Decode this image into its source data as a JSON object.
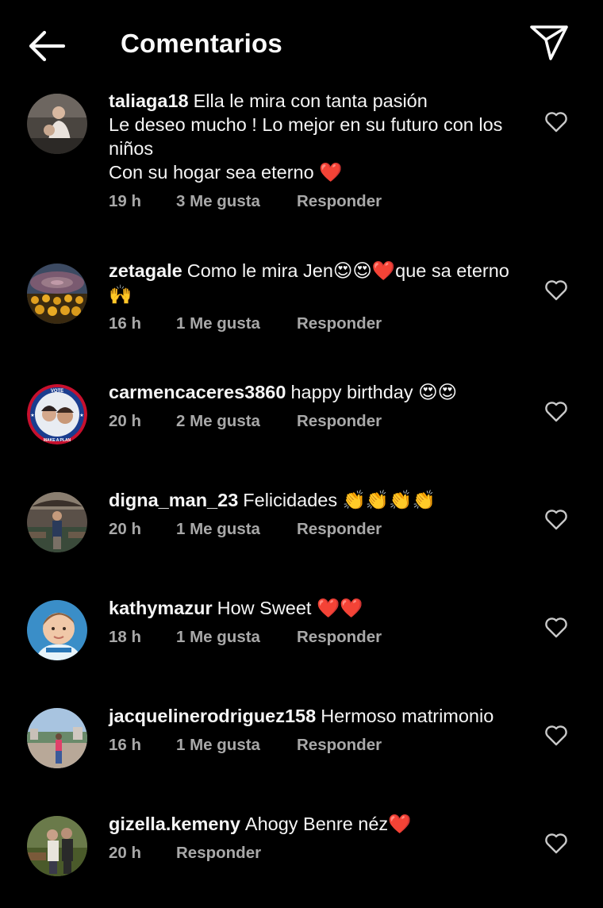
{
  "header": {
    "title": "Comentarios",
    "back_icon": "arrow-left-icon",
    "share_icon": "paper-plane-icon"
  },
  "comments": [
    {
      "username": "taliaga18",
      "text": "Ella le mira con tanta pasión\nLe deseo mucho ! Lo mejor en su futuro con los niños\nCon su hogar sea eterno ❤️",
      "time": "19 h",
      "likes": "3 Me gusta",
      "reply": "Responder"
    },
    {
      "username": "zetagale",
      "text": "Como le mira Jen😍😍❤️que sa eterno🙌",
      "time": "16 h",
      "likes": "1 Me gusta",
      "reply": "Responder"
    },
    {
      "username": "carmencaceres3860",
      "text": "happy birthday 😍😍",
      "time": "20 h",
      "likes": "2 Me gusta",
      "reply": "Responder",
      "avatar_badge_top": "VOTE",
      "avatar_badge_bottom": "MAKE A PLAN"
    },
    {
      "username": "digna_man_23",
      "text": "Felicidades 👏👏👏👏",
      "time": "20 h",
      "likes": "1 Me gusta",
      "reply": "Responder"
    },
    {
      "username": "kathymazur",
      "text": "How Sweet ❤️❤️",
      "time": "18 h",
      "likes": "1 Me gusta",
      "reply": "Responder"
    },
    {
      "username": "jacquelinerodriguez158",
      "text": "Hermoso matrimonio",
      "time": "16 h",
      "likes": "1 Me gusta",
      "reply": "Responder"
    },
    {
      "username": "gizella.kemeny",
      "text": "Ahogy Benre néz❤️",
      "time": "20 h",
      "likes": "",
      "reply": "Responder"
    }
  ],
  "colors": {
    "background": "#000000",
    "text_primary": "#f5f5f5",
    "text_secondary": "#a8a8a8",
    "heart_red": "#e0152a",
    "emoji_yellow": "#f5c518"
  }
}
